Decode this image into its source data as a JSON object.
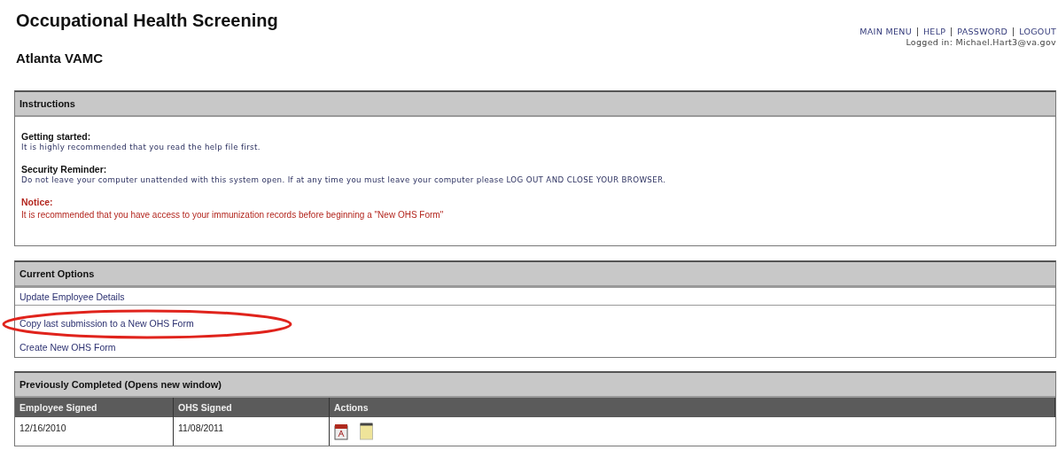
{
  "header": {
    "title": "Occupational Health Screening",
    "subtitle": "Atlanta VAMC",
    "nav_links": [
      "MAIN MENU",
      "HELP",
      "PASSWORD",
      "LOGOUT"
    ],
    "logged_in": "Logged in: Michael.Hart3@va.gov"
  },
  "instructions": {
    "title": "Instructions",
    "sections": [
      {
        "kind": "normal",
        "heading": "Getting started:",
        "text": "It is highly recommended that you read the help file first."
      },
      {
        "kind": "normal",
        "heading": "Security Reminder:",
        "text": "Do not leave your computer unattended with this system open. If at any time you must leave your computer please LOG OUT AND CLOSE YOUR BROWSER."
      },
      {
        "kind": "notice",
        "heading": "Notice:",
        "text": "It is recommended that you have access to your immunization records before beginning a \"New OHS Form\""
      }
    ]
  },
  "current_options": {
    "title": "Current Options",
    "rows": [
      [
        "Update Employee Details"
      ],
      [
        "Copy last submission to a New OHS Form",
        "Create New OHS Form"
      ]
    ]
  },
  "previously_completed": {
    "title": "Previously Completed (Opens new window)",
    "columns": [
      "Employee Signed",
      "OHS Signed",
      "Actions"
    ],
    "rows": [
      {
        "employee_signed": "12/16/2010",
        "ohs_signed": "11/08/2011"
      }
    ]
  }
}
